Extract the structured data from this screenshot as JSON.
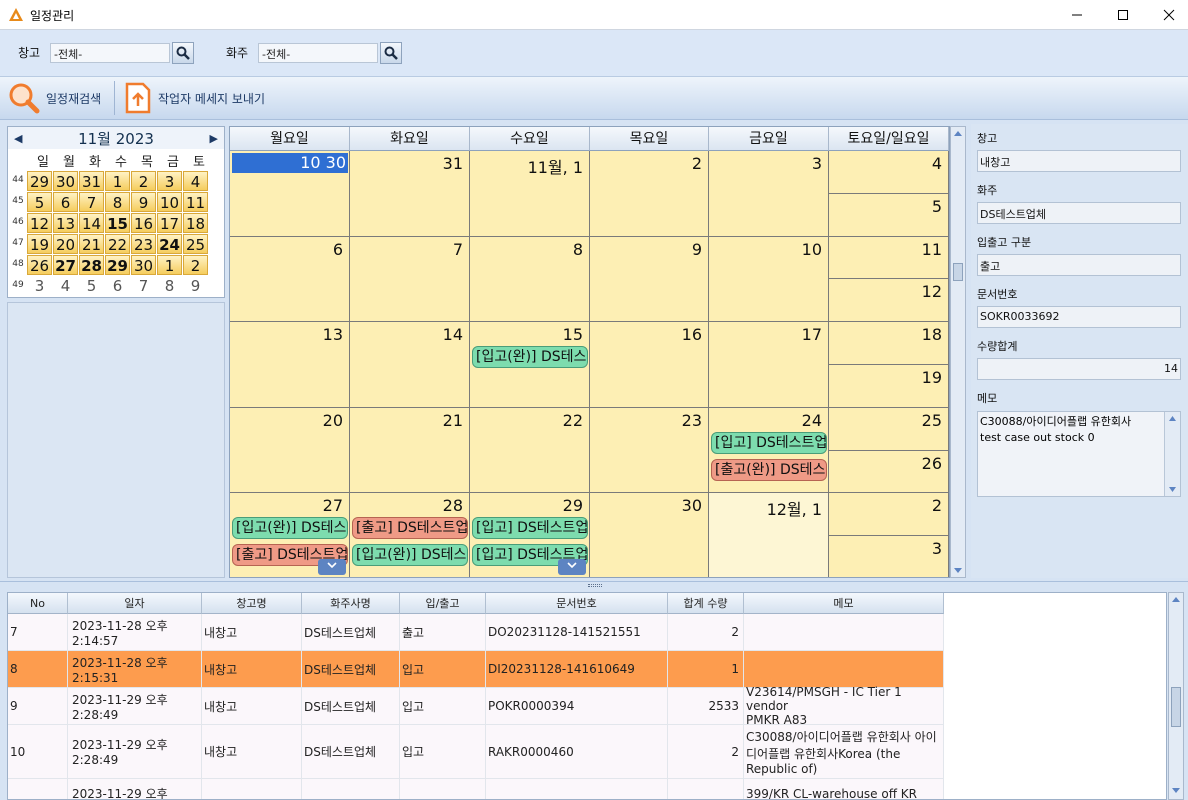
{
  "window": {
    "title": "일정관리",
    "minimize_icon": "minimize-icon",
    "maximize_icon": "maximize-icon",
    "close_icon": "close-icon"
  },
  "filter": {
    "warehouse_label": "창고",
    "warehouse_value": "-전체-",
    "owner_label": "화주",
    "owner_value": "-전체-"
  },
  "toolbar": {
    "research_label": "일정재검색",
    "send_label": "작업자 메세지 보내기"
  },
  "minical": {
    "title": "11월 2023",
    "dow": [
      "일",
      "월",
      "화",
      "수",
      "목",
      "금",
      "토"
    ],
    "weeks": [
      {
        "wk": "44",
        "days": [
          "29",
          "30",
          "31",
          "1",
          "2",
          "3",
          "4"
        ]
      },
      {
        "wk": "45",
        "days": [
          "5",
          "6",
          "7",
          "8",
          "9",
          "10",
          "11"
        ]
      },
      {
        "wk": "46",
        "days": [
          "12",
          "13",
          "14",
          "15",
          "16",
          "17",
          "18"
        ]
      },
      {
        "wk": "47",
        "days": [
          "19",
          "20",
          "21",
          "22",
          "23",
          "24",
          "25"
        ]
      },
      {
        "wk": "48",
        "days": [
          "26",
          "27",
          "28",
          "29",
          "30",
          "1",
          "2"
        ]
      },
      {
        "wk": "49",
        "days": [
          "3",
          "4",
          "5",
          "6",
          "7",
          "8",
          "9"
        ]
      }
    ]
  },
  "month": {
    "headers": [
      "월요일",
      "화요일",
      "수요일",
      "목요일",
      "금요일",
      "토요일/일요일"
    ],
    "rows": [
      {
        "days": [
          "10 30",
          "31",
          "11월, 1",
          "2",
          "3"
        ],
        "sat": "4",
        "sun": "5"
      },
      {
        "days": [
          "6",
          "7",
          "8",
          "9",
          "10"
        ],
        "sat": "11",
        "sun": "12"
      },
      {
        "days": [
          "13",
          "14",
          "15",
          "16",
          "17"
        ],
        "sat": "18",
        "sun": "19"
      },
      {
        "days": [
          "20",
          "21",
          "22",
          "23",
          "24"
        ],
        "sat": "25",
        "sun": "26"
      },
      {
        "days": [
          "27",
          "28",
          "29",
          "30",
          "12월, 1"
        ],
        "sat": "2",
        "sun": "3"
      }
    ],
    "appointments": {
      "r2c2": "[입고(완)] DS테스",
      "r3c4a": "[입고] DS테스트업",
      "r3c4b": "[출고(완)] DS테스",
      "r4c0a": "[입고(완)] DS테스",
      "r4c0b": "[출고] DS테스트업",
      "r4c1a": "[출고] DS테스트업",
      "r4c1b": "[입고(완)] DS테스",
      "r4c2a": "[입고] DS테스트업",
      "r4c2b": "[입고] DS테스트업"
    }
  },
  "detail": {
    "warehouse_label": "창고",
    "warehouse_value": "내창고",
    "owner_label": "화주",
    "owner_value": "DS테스트업체",
    "type_label": "입출고 구분",
    "type_value": "출고",
    "doc_label": "문서번호",
    "doc_value": "SOKR0033692",
    "qty_label": "수량합계",
    "qty_value": "14",
    "memo_label": "메모",
    "memo_line1": "C30088/아이디어플랩 유한회사",
    "memo_line2": "test case out stock 0"
  },
  "grid": {
    "headers": [
      "No",
      "일자",
      "창고명",
      "화주사명",
      "입/출고",
      "문서번호",
      "합계 수량",
      "메모"
    ],
    "rows": [
      {
        "no": "7",
        "date1": "2023-11-28 오후",
        "date2": "2:14:57",
        "wh": "내창고",
        "owner": "DS테스트업체",
        "io": "출고",
        "doc": "DO20231128-141521551",
        "qty": "2",
        "memo1": "",
        "memo2": "",
        "memo3": ""
      },
      {
        "no": "8",
        "date1": "2023-11-28 오후",
        "date2": "2:15:31",
        "wh": "내창고",
        "owner": "DS테스트업체",
        "io": "입고",
        "doc": "DI20231128-141610649",
        "qty": "1",
        "memo1": "",
        "memo2": "",
        "memo3": ""
      },
      {
        "no": "9",
        "date1": "2023-11-29 오후",
        "date2": "2:28:49",
        "wh": "내창고",
        "owner": "DS테스트업체",
        "io": "입고",
        "doc": "POKR0000394",
        "qty": "2533",
        "memo1": "V23614/PMSGH - IC Tier 1 vendor",
        "memo2": "PMKR A83",
        "memo3": ""
      },
      {
        "no": "10",
        "date1": "2023-11-29 오후",
        "date2": "2:28:49",
        "wh": "내창고",
        "owner": "DS테스트업체",
        "io": "입고",
        "doc": "RAKR0000460",
        "qty": "2",
        "memo1": "C30088/아이디어플랩 유한회사 아이",
        "memo2": "디어플랩 유한회사Korea (the",
        "memo3": "Republic of)"
      },
      {
        "no": "",
        "date1": "2023-11-29 오후",
        "date2": "",
        "wh": "",
        "owner": "",
        "io": "",
        "doc": "",
        "qty": "",
        "memo1": "399/KR CL-warehouse off KR",
        "memo2": "",
        "memo3": ""
      }
    ]
  },
  "colors": {
    "selected_row": "#fd9c4e",
    "appt_green": "#7ddcae",
    "appt_red": "#ef9a86",
    "cell_bg": "#fdefb4",
    "selected_day": "#2f6fd3"
  }
}
